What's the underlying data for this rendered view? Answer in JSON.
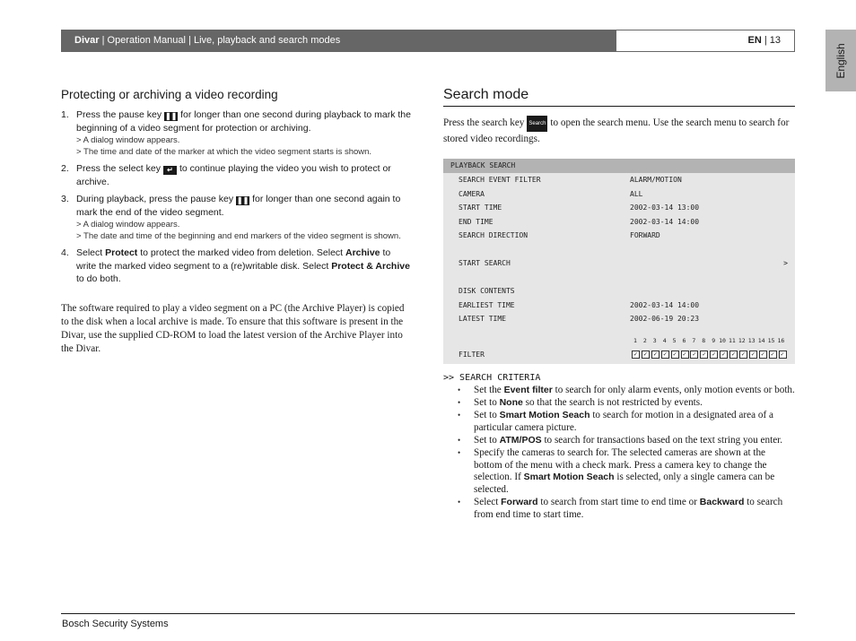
{
  "header": {
    "product": "Divar",
    "sep": " | ",
    "manual": "Operation Manual",
    "section": "Live, playback and search modes",
    "lang_code": "EN",
    "page_sep": " | ",
    "page_number": "13",
    "lang_tab": "English"
  },
  "left": {
    "heading": "Protecting or archiving a video recording",
    "steps": [
      {
        "num": "1.",
        "pre": "Press the pause key",
        "key_icon": "pause-key",
        "post": "for longer than one second during playback to mark the beginning of a video segment for protection or archiving.",
        "results": [
          "> A dialog window appears.",
          "> The time and date of the marker at which the video segment starts is shown."
        ]
      },
      {
        "num": "2.",
        "pre": "Press the select key",
        "key_icon": "select-key",
        "post": "to continue playing the video you wish to protect or archive.",
        "results": []
      },
      {
        "num": "3.",
        "pre": "During playback, press the pause key",
        "key_icon": "pause-key",
        "post": "for longer than one second again to mark the end of the video segment.",
        "results": [
          "> A dialog window appears.",
          "> The date and time of the beginning and end markers of the video segment is shown."
        ]
      },
      {
        "num": "4.",
        "t1": "Select ",
        "b1": "Protect",
        "t2": " to protect the marked video from deletion. Select ",
        "b2": "Archive",
        "t3": " to write the marked video segment to a (re)writable disk. Select ",
        "b3": "Protect & Archive",
        "t4": " to do both."
      }
    ],
    "paragraph": "The software required to play a video segment on a PC (the Archive Player) is copied to the disk when a local archive is made. To ensure that this software is present in the Divar, use the supplied CD-ROM to load the latest version of the Archive Player into the Divar."
  },
  "right": {
    "heading": "Search mode",
    "intro_pre": "Press the search key",
    "search_key_label": "Search",
    "intro_post": "to open the search menu. Use the search menu to search for stored video recordings.",
    "menu": {
      "title": "PLAYBACK SEARCH",
      "rows": [
        {
          "label": "SEARCH EVENT FILTER",
          "value": "ALARM/MOTION"
        },
        {
          "label": "CAMERA",
          "value": "ALL"
        },
        {
          "label": "START TIME",
          "value": "2002-03-14 13:00"
        },
        {
          "label": "END TIME",
          "value": "2002-03-14 14:00"
        },
        {
          "label": "SEARCH DIRECTION",
          "value": "FORWARD"
        }
      ],
      "start_search": "START SEARCH",
      "start_arrow": ">",
      "disk_contents": "DISK CONTENTS",
      "disk_rows": [
        {
          "label": "EARLIEST TIME",
          "value": "2002-03-14 14:00"
        },
        {
          "label": "LATEST TIME",
          "value": "2002-06-19 20:23"
        }
      ],
      "cameras": [
        "1",
        "2",
        "3",
        "4",
        "5",
        "6",
        "7",
        "8",
        "9",
        "10",
        "11",
        "12",
        "13",
        "14",
        "15",
        "16"
      ],
      "cameras_checked": [
        true,
        true,
        true,
        true,
        true,
        true,
        true,
        true,
        true,
        true,
        true,
        true,
        true,
        true,
        true,
        true
      ],
      "filter_label": "FILTER"
    },
    "criteria_heading": ">> SEARCH CRITERIA",
    "bullets": [
      {
        "t1": "Set the ",
        "b1": "Event filter",
        "t2": " to search for only alarm events, only motion events or both."
      },
      {
        "t1": "Set to ",
        "b1": "None",
        "t2": " so that the search is not restricted by events."
      },
      {
        "t1": "Set to ",
        "b1": "Smart Motion Seach",
        "t2": " to search for motion in a designated area of a particular camera picture."
      },
      {
        "t1": "Set to ",
        "b1": "ATM/POS",
        "t2": " to search for transactions based on the text string you enter."
      },
      {
        "t1": "Specify the cameras to search for. The selected cameras are shown at the bottom of the menu with a check mark. Press a camera key to change the selection. If ",
        "b1": "Smart Motion Seach",
        "t2": " is selected, only a single camera can be selected."
      },
      {
        "t1": "Select ",
        "b1": "Forward",
        "t2": " to search from start time to end time or ",
        "b2": "Backward",
        "t3": " to search from end time to start time."
      }
    ]
  },
  "footer": {
    "company": "Bosch Security Systems"
  }
}
